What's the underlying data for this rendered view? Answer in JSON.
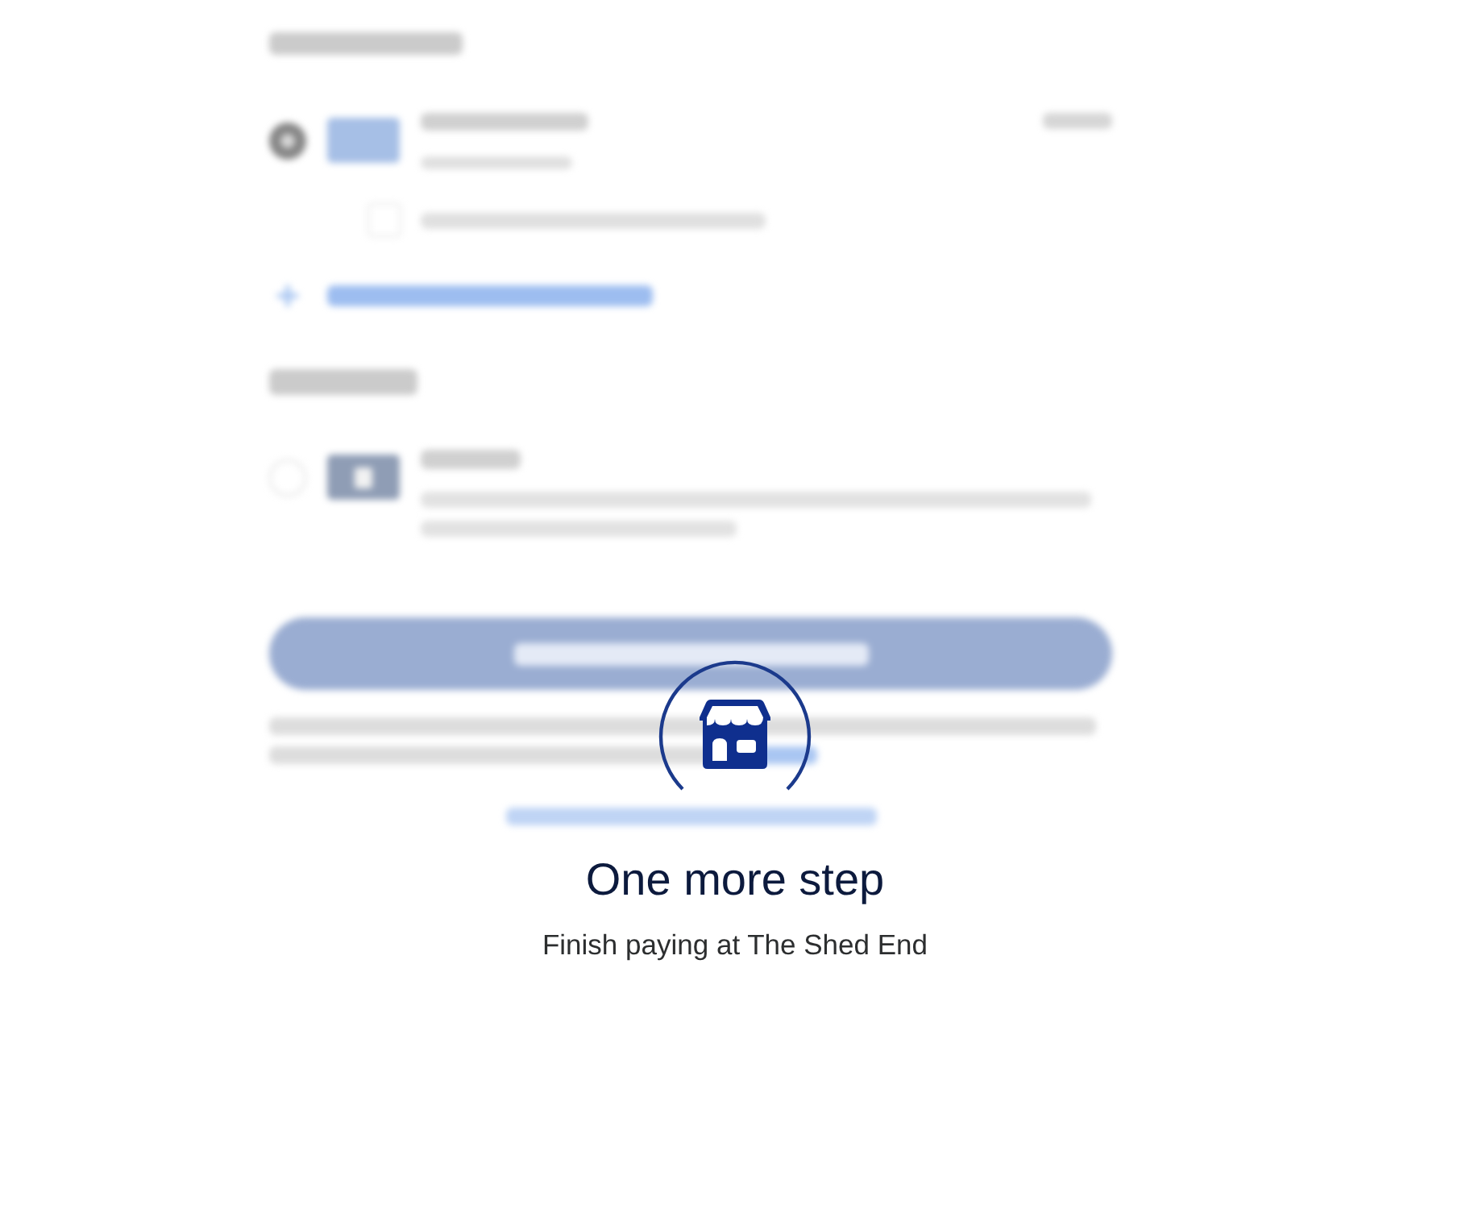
{
  "overlay": {
    "title": "One more step",
    "message": "Finish paying at The Shed End"
  }
}
